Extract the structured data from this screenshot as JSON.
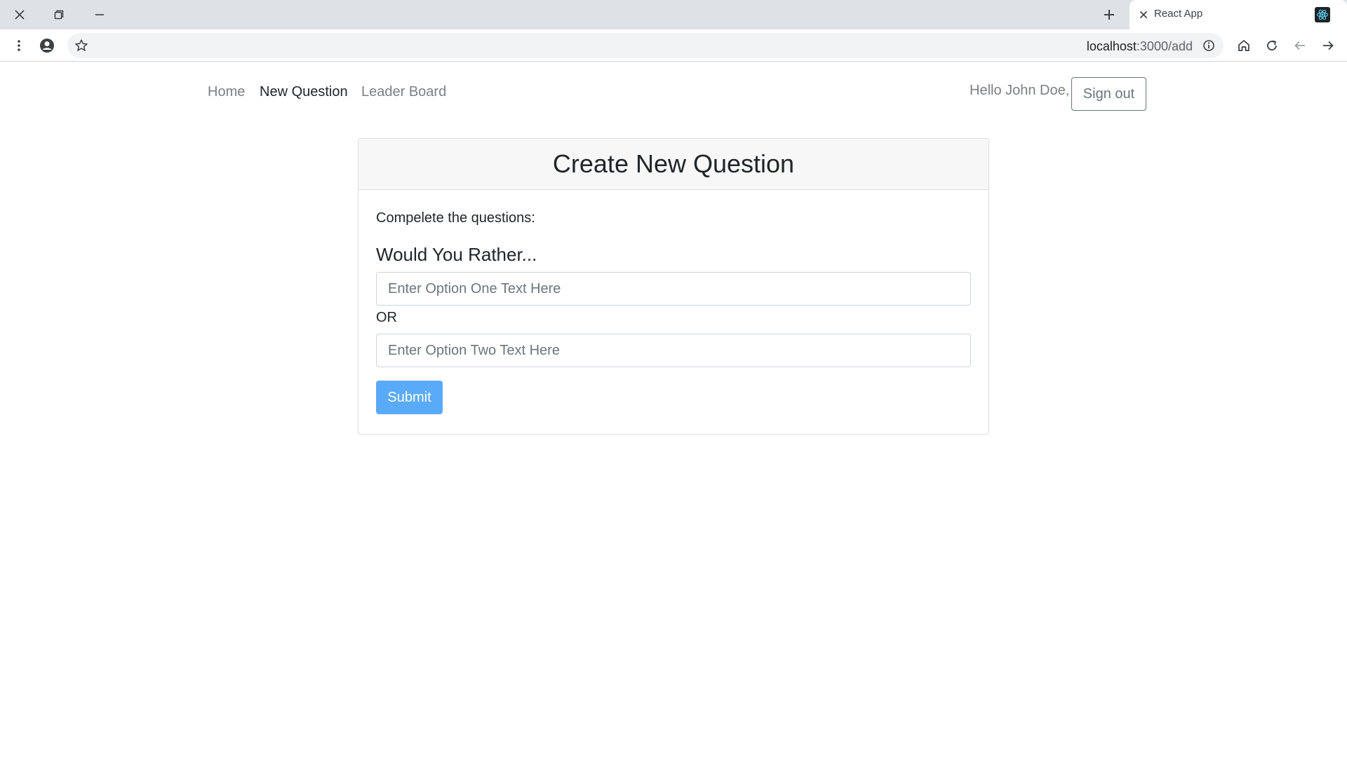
{
  "browser": {
    "tab_title": "React App",
    "url_host": "localhost",
    "url_path": ":3000/add"
  },
  "navbar": {
    "links": [
      {
        "label": "Home",
        "active": false
      },
      {
        "label": "New Question",
        "active": true
      },
      {
        "label": "Leader Board",
        "active": false
      }
    ],
    "greeting": "Hello John Doe,",
    "signout_label": "Sign out"
  },
  "form": {
    "title": "Create New Question",
    "instructions": "Compelete the questions:",
    "heading": "Would You Rather...",
    "option_one_placeholder": "Enter Option One Text Here",
    "option_one_value": "",
    "or_label": "OR",
    "option_two_placeholder": "Enter Option Two Text Here",
    "option_two_value": "",
    "submit_label": "Submit"
  },
  "colors": {
    "submit_bg": "#5aabf7",
    "tabstrip_bg": "#dee1e6",
    "nav_muted": "#7c7f82",
    "text": "#212529"
  },
  "icons": {
    "window_close": "close-icon",
    "window_restore": "restore-icon",
    "window_minimize": "minimize-icon",
    "new_tab": "plus-icon",
    "tab_close": "close-icon",
    "favicon": "react-logo-icon",
    "menu": "kebab-menu-icon",
    "profile": "account-circle-icon",
    "bookmark": "star-icon",
    "site_info": "info-icon",
    "home": "home-icon",
    "reload": "reload-icon",
    "back": "arrow-left-icon",
    "forward": "arrow-right-icon"
  }
}
